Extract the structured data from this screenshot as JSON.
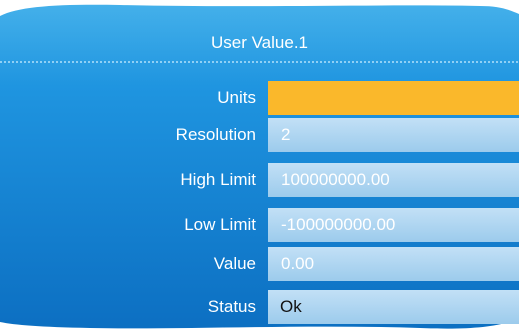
{
  "window": {
    "title": "User Value.1"
  },
  "fields": [
    {
      "label": "Units",
      "value": ""
    },
    {
      "label": "Resolution",
      "value": "2"
    },
    {
      "label": "High Limit",
      "value": "100000000.00"
    },
    {
      "label": "Low Limit",
      "value": "-100000000.00"
    },
    {
      "label": "Value",
      "value": "0.00"
    },
    {
      "label": "Status",
      "value": "Ok"
    }
  ],
  "colors": {
    "panel": "#1a8fdb",
    "field": "#aed5f1",
    "focused_field": "#fab82b"
  }
}
